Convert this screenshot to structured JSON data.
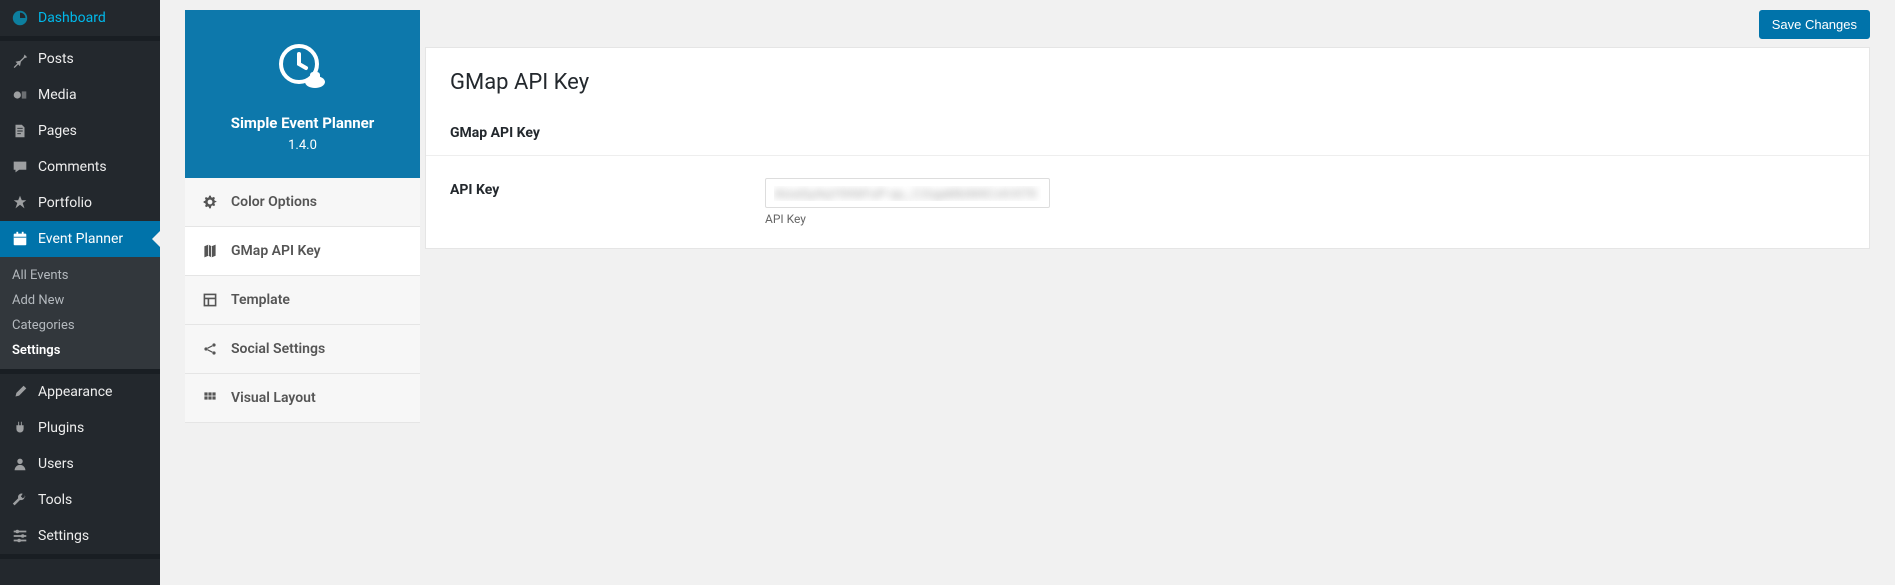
{
  "sidebar": {
    "items": [
      {
        "label": "Dashboard"
      },
      {
        "label": "Posts"
      },
      {
        "label": "Media"
      },
      {
        "label": "Pages"
      },
      {
        "label": "Comments"
      },
      {
        "label": "Portfolio"
      },
      {
        "label": "Event Planner"
      },
      {
        "label": "Appearance"
      },
      {
        "label": "Plugins"
      },
      {
        "label": "Users"
      },
      {
        "label": "Tools"
      },
      {
        "label": "Settings"
      }
    ],
    "submenu": [
      {
        "label": "All Events"
      },
      {
        "label": "Add New"
      },
      {
        "label": "Categories"
      },
      {
        "label": "Settings"
      }
    ]
  },
  "settings_panel": {
    "title": "Simple Event Planner",
    "version": "1.4.0",
    "tabs": [
      {
        "label": "Color Options"
      },
      {
        "label": "GMap API Key"
      },
      {
        "label": "Template"
      },
      {
        "label": "Social Settings"
      },
      {
        "label": "Visual Layout"
      }
    ]
  },
  "main": {
    "save_label": "Save Changes",
    "heading": "GMap API Key",
    "section": "GMap API Key",
    "field_label": "API Key",
    "field_value": "AIzaSyAqY9XkFuP-qu_C2rgaMlzM4CcKXl79",
    "field_desc": "API Key"
  }
}
